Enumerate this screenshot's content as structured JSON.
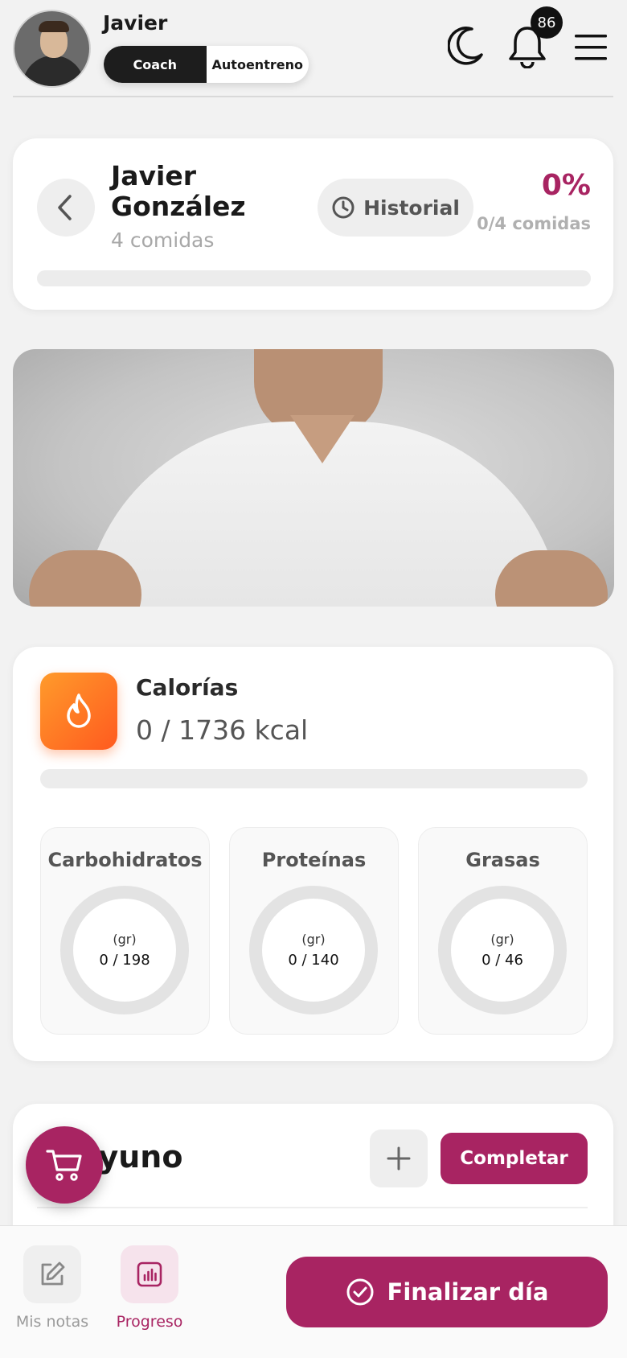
{
  "header": {
    "user_name": "Javier",
    "modes": [
      "Coach",
      "Autoentreno"
    ],
    "active_mode": "Coach",
    "notifications_count": "86",
    "icons": [
      "moon-icon",
      "bell-icon",
      "menu-icon"
    ]
  },
  "summary": {
    "client_name": "Javier González",
    "meals_label": "4 comidas",
    "history_label": "Historial",
    "percent": "0%",
    "progress_label": "0/4 comidas",
    "progress_fraction": 0
  },
  "calories": {
    "title": "Calorías",
    "value": "0 / 1736 kcal",
    "consumed": 0,
    "target": 1736
  },
  "macros": [
    {
      "name": "Carbohidratos",
      "unit": "(gr)",
      "value": "0 / 198"
    },
    {
      "name": "Proteínas",
      "unit": "(gr)",
      "value": "0 / 140"
    },
    {
      "name": "Grasas",
      "unit": "(gr)",
      "value": "0 / 46"
    }
  ],
  "meal": {
    "title_visible": "ayuno",
    "complete_label": "Completar"
  },
  "bottom_nav": {
    "items": [
      {
        "label": "Mis notas",
        "icon": "edit-icon",
        "active": false
      },
      {
        "label": "Progreso",
        "icon": "chart-icon",
        "active": true
      }
    ],
    "finish_label": "Finalizar día"
  },
  "colors": {
    "accent": "#a82462",
    "calorie_gradient_start": "#ff9b2b",
    "calorie_gradient_end": "#ff5a1f"
  }
}
